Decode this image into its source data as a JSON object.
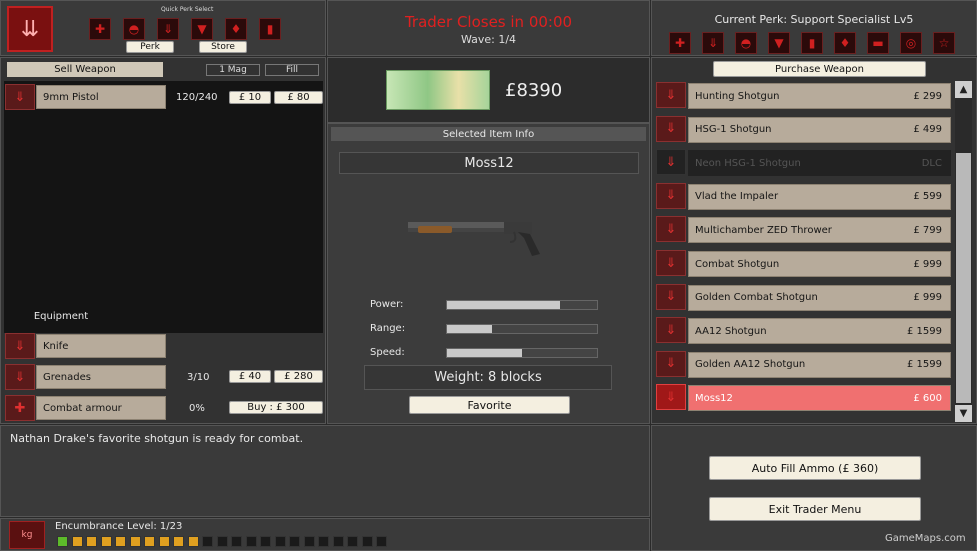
{
  "quick_perk": {
    "title": "Quick Perk Select",
    "icons": [
      "medic-cross-icon",
      "arrow-down-icon",
      "shield-skull-icon",
      "down-arrow-icon",
      "flame-icon",
      "boots-icon"
    ],
    "perk_label": "Perk",
    "store_label": "Store"
  },
  "header": {
    "trader_closes": "Trader Closes in 00:00",
    "wave": "Wave: 1/4",
    "current_perk": "Current Perk: Support Specialist Lv5",
    "perk_icons": [
      "medic-cross-icon",
      "arrow-down-icon",
      "shield-skull-icon",
      "down-arrow-icon",
      "bullet-icon",
      "flame-icon",
      "boots-icon",
      "target-icon",
      "star-icon"
    ]
  },
  "sell": {
    "title": "Sell Weapon",
    "mag_label": "1 Mag",
    "fill_label": "Fill",
    "weapons": [
      {
        "name": "9mm Pistol",
        "ammo": "120/240",
        "mag_price": "£ 10",
        "fill_price": "£ 80"
      }
    ],
    "equipment_title": "Equipment",
    "equipment": [
      {
        "name": "Knife",
        "ammo": "",
        "b1": "",
        "b2": ""
      },
      {
        "name": "Grenades",
        "ammo": "3/10",
        "b1": "£ 40",
        "b2": "£ 280"
      },
      {
        "name": "Combat armour",
        "ammo": "0%",
        "b1": "Buy : £ 300",
        "b2": ""
      }
    ]
  },
  "money": "£8390",
  "selected": {
    "title": "Selected Item Info",
    "name": "Moss12",
    "power_label": "Power:",
    "range_label": "Range:",
    "speed_label": "Speed:",
    "power": 0.75,
    "range": 0.3,
    "speed": 0.5,
    "weight": "Weight: 8 blocks",
    "favorite_label": "Favorite"
  },
  "purchase": {
    "title": "Purchase Weapon",
    "items": [
      {
        "name": "Hunting Shotgun",
        "price": "£ 299",
        "state": "normal"
      },
      {
        "name": "HSG-1 Shotgun",
        "price": "£ 499",
        "state": "normal"
      },
      {
        "name": "Neon HSG-1 Shotgun",
        "price": "DLC",
        "state": "dlc"
      },
      {
        "name": "Vlad the Impaler",
        "price": "£ 599",
        "state": "normal"
      },
      {
        "name": "Multichamber ZED Thrower",
        "price": "£ 799",
        "state": "normal"
      },
      {
        "name": "Combat Shotgun",
        "price": "£ 999",
        "state": "normal"
      },
      {
        "name": "Golden Combat Shotgun",
        "price": "£ 999",
        "state": "normal"
      },
      {
        "name": "AA12 Shotgun",
        "price": "£ 1599",
        "state": "normal"
      },
      {
        "name": "Golden AA12 Shotgun",
        "price": "£ 1599",
        "state": "normal"
      },
      {
        "name": "Moss12",
        "price": "£ 600",
        "state": "selected"
      }
    ]
  },
  "description": "Nathan Drake's favorite shotgun is ready for combat.",
  "auto_fill": "Auto Fill Ammo (£ 360)",
  "exit": "Exit Trader Menu",
  "encumbrance": {
    "label": "Encumbrance Level: 1/23",
    "kg": "kg",
    "filled": 1,
    "partial": 10,
    "total": 23
  },
  "watermark": "GameMaps.com",
  "colors": {
    "accent": "#d02020",
    "selected_row": "#f07070",
    "tan": "#b7ab9b",
    "encumbrance_green": "#5dbb2a",
    "encumbrance_orange": "#e0a020"
  }
}
